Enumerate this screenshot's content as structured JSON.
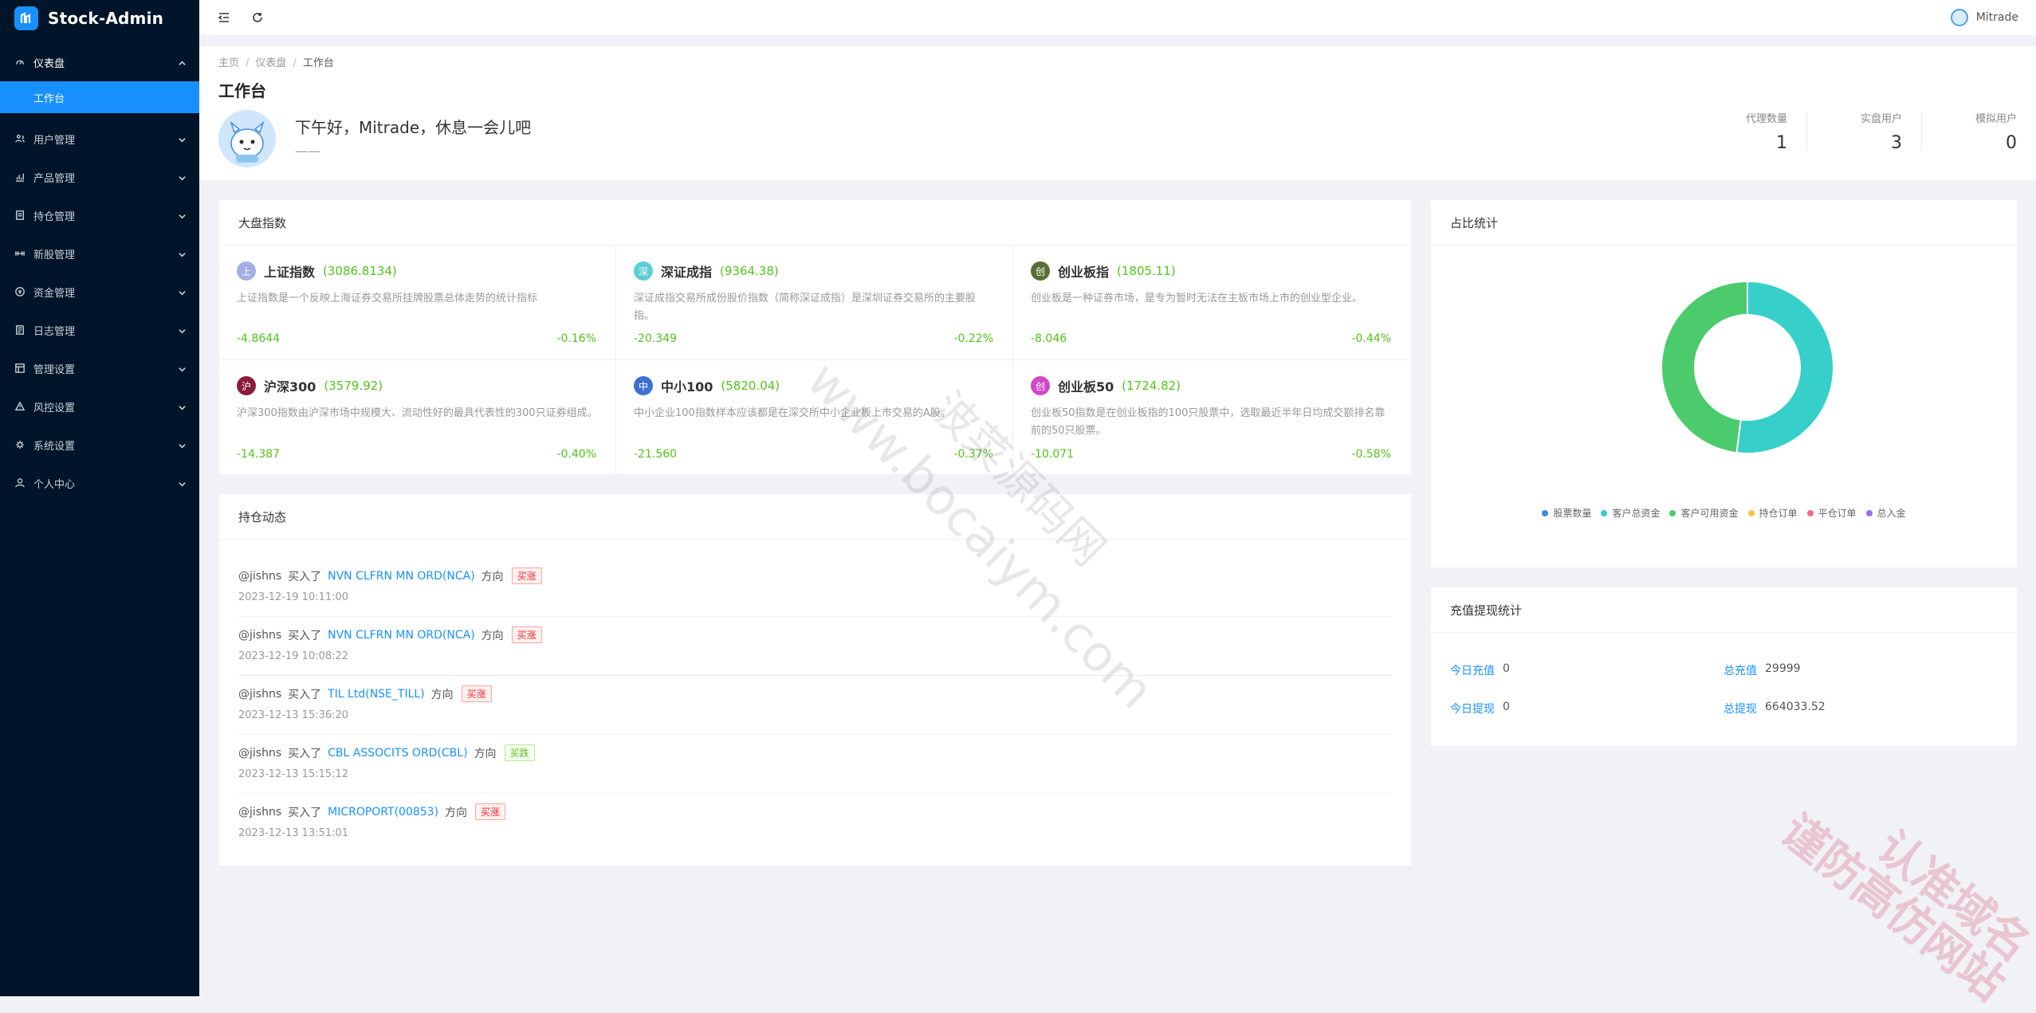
{
  "app": {
    "title": "Stock-Admin"
  },
  "sidebar": {
    "items": [
      {
        "label": "仪表盘",
        "icon": "dashboard-icon",
        "open": true
      },
      {
        "label": "用户管理",
        "icon": "users-icon"
      },
      {
        "label": "产品管理",
        "icon": "chart-icon"
      },
      {
        "label": "持仓管理",
        "icon": "position-icon"
      },
      {
        "label": "新股管理",
        "icon": "ipo-icon"
      },
      {
        "label": "资金管理",
        "icon": "funds-icon"
      },
      {
        "label": "日志管理",
        "icon": "log-icon"
      },
      {
        "label": "管理设置",
        "icon": "admin-settings-icon"
      },
      {
        "label": "风控设置",
        "icon": "risk-icon"
      },
      {
        "label": "系统设置",
        "icon": "gear-icon"
      },
      {
        "label": "个人中心",
        "icon": "person-icon"
      }
    ],
    "sub_active": "工作台"
  },
  "header": {
    "user": "Mitrade"
  },
  "breadcrumb": [
    "主页",
    "仪表盘",
    "工作台"
  ],
  "page": {
    "title": "工作台",
    "greeting": "下午好，Mitrade，休息一会儿吧",
    "greeting_sub": "——"
  },
  "stats": [
    {
      "label": "代理数量",
      "value": "1"
    },
    {
      "label": "实盘用户",
      "value": "3"
    },
    {
      "label": "模拟用户",
      "value": "0"
    }
  ],
  "market": {
    "title": "大盘指数",
    "indices": [
      {
        "badge": "上",
        "color": "#a3aee8",
        "name": "上证指数",
        "value": "(3086.8134)",
        "desc": "上证指数是一个反映上海证券交易所挂牌股票总体走势的统计指标",
        "change": "-4.8644",
        "pct": "-0.16%"
      },
      {
        "badge": "深",
        "color": "#5ccfd6",
        "name": "深证成指",
        "value": "(9364.38)",
        "desc": "深证成指交易所成份股价指数（简称深证成指）是深圳证券交易所的主要股指。",
        "change": "-20.349",
        "pct": "-0.22%"
      },
      {
        "badge": "创",
        "color": "#5d6d35",
        "name": "创业板指",
        "value": "(1805.11)",
        "desc": "创业板是一种证券市场，是专为暂时无法在主板市场上市的创业型企业。",
        "change": "-8.046",
        "pct": "-0.44%"
      },
      {
        "badge": "沪",
        "color": "#8a1c3c",
        "name": "沪深300",
        "value": "(3579.92)",
        "desc": "沪深300指数由沪深市场中规模大、流动性好的最具代表性的300只证券组成。",
        "change": "-14.387",
        "pct": "-0.40%"
      },
      {
        "badge": "中",
        "color": "#3f6fd0",
        "name": "中小100",
        "value": "(5820.04)",
        "desc": "中小企业100指数样本应该都是在深交所中小企业板上市交易的A股。",
        "change": "-21.560",
        "pct": "-0.37%"
      },
      {
        "badge": "创",
        "color": "#d147c7",
        "name": "创业板50",
        "value": "(1724.82)",
        "desc": "创业板50指数是在创业板指的100只股票中，选取最近半年日均成交额排名靠前的50只股票。",
        "change": "-10.071",
        "pct": "-0.58%"
      }
    ]
  },
  "positions": {
    "title": "持仓动态",
    "buy_text": "买入了",
    "dir_text": "方向",
    "items": [
      {
        "user": "@jishns",
        "stock": "NVN CLFRN MN ORD(NCA)",
        "tag": "买涨",
        "up": true,
        "time": "2023-12-19 10:11:00"
      },
      {
        "user": "@jishns",
        "stock": "NVN CLFRN MN ORD(NCA)",
        "tag": "买涨",
        "up": true,
        "time": "2023-12-19 10:08:22"
      },
      {
        "user": "@jishns",
        "stock": "TIL Ltd(NSE_TILL)",
        "tag": "买涨",
        "up": true,
        "time": "2023-12-13 15:36:20"
      },
      {
        "user": "@jishns",
        "stock": "CBL ASSOCITS ORD(CBL)",
        "tag": "买跌",
        "up": false,
        "time": "2023-12-13 15:15:12"
      },
      {
        "user": "@jishns",
        "stock": "MICROPORT(00853)",
        "tag": "买涨",
        "up": true,
        "time": "2023-12-13 13:51:01"
      }
    ]
  },
  "ratio": {
    "title": "占比统计",
    "legend": [
      {
        "name": "股票数量",
        "color": "#3a8ee6"
      },
      {
        "name": "客户总资金",
        "color": "#36cfc9"
      },
      {
        "name": "客户可用资金",
        "color": "#4ccb6c"
      },
      {
        "name": "持仓订单",
        "color": "#f5c542"
      },
      {
        "name": "平仓订单",
        "color": "#f06b7d"
      },
      {
        "name": "总入金",
        "color": "#9b6be8"
      }
    ]
  },
  "chart_data": {
    "type": "pie",
    "donut": true,
    "categories": [
      "股票数量",
      "客户总资金",
      "客户可用资金",
      "持仓订单",
      "平仓订单",
      "总入金"
    ],
    "values": [
      0,
      52,
      48,
      0,
      0,
      0
    ],
    "colors": [
      "#3a8ee6",
      "#36cfc9",
      "#4ccb6c",
      "#f5c542",
      "#f06b7d",
      "#9b6be8"
    ],
    "legend_position": "bottom"
  },
  "finance": {
    "title": "充值提现统计",
    "rows": [
      [
        {
          "label": "今日充值",
          "value": "0"
        },
        {
          "label": "总充值",
          "value": "29999"
        }
      ],
      [
        {
          "label": "今日提现",
          "value": "0"
        },
        {
          "label": "总提现",
          "value": "664033.52"
        }
      ]
    ]
  },
  "watermark": {
    "url": "www.bocaiym.com",
    "cn": "波菜源码网",
    "pink_1": "认准域名",
    "pink_2": "谨防高仿网站"
  }
}
